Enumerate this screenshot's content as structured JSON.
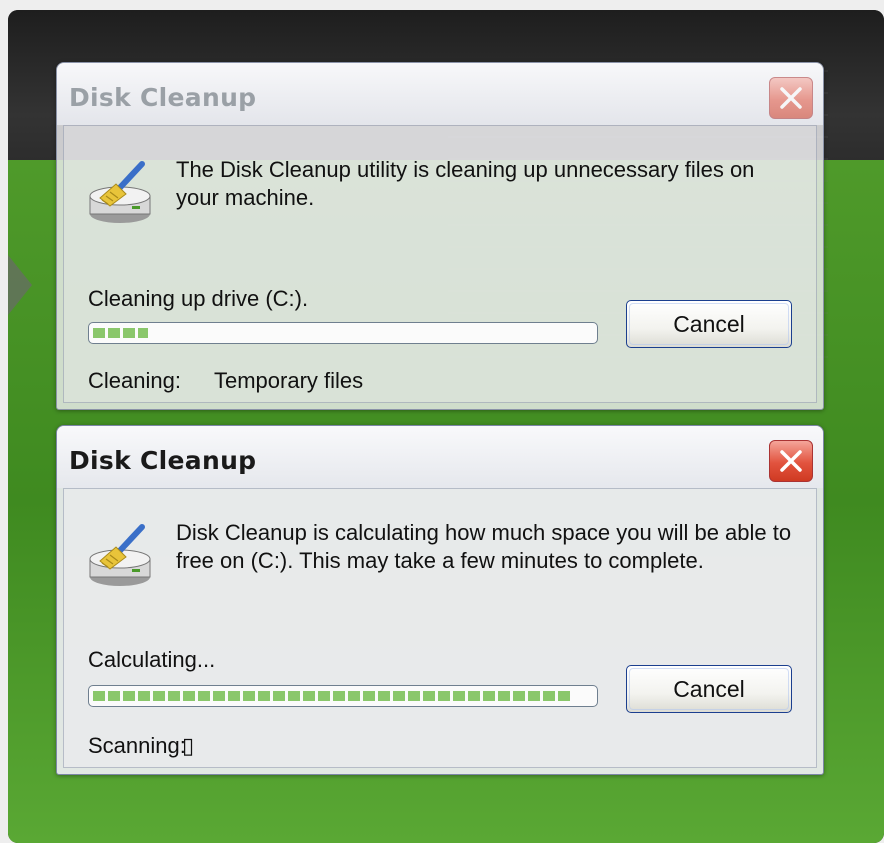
{
  "dialogs": [
    {
      "title": "Disk Cleanup",
      "message": "The Disk Cleanup utility is cleaning up unnecessary files on your machine.",
      "status": "Cleaning up drive  (C:).",
      "progress": 0.11,
      "detail_label": "Cleaning:",
      "detail_value": "Temporary files",
      "cancel_label": "Cancel",
      "active": false
    },
    {
      "title": "Disk Cleanup",
      "message": "Disk Cleanup is calculating how much space you will be able to free on  (C:). This may take a few minutes to complete.",
      "status": "Calculating...",
      "progress": 0.96,
      "detail_label": "Scanning:",
      "detail_value": "▯",
      "cancel_label": "Cancel",
      "active": true
    }
  ],
  "icons": {
    "app": "disk-cleanup-icon",
    "close": "close-icon"
  },
  "colors": {
    "progress_fill": "#8ac76b",
    "close_button": "#e2533e",
    "background_green": "#4f9a2a"
  }
}
